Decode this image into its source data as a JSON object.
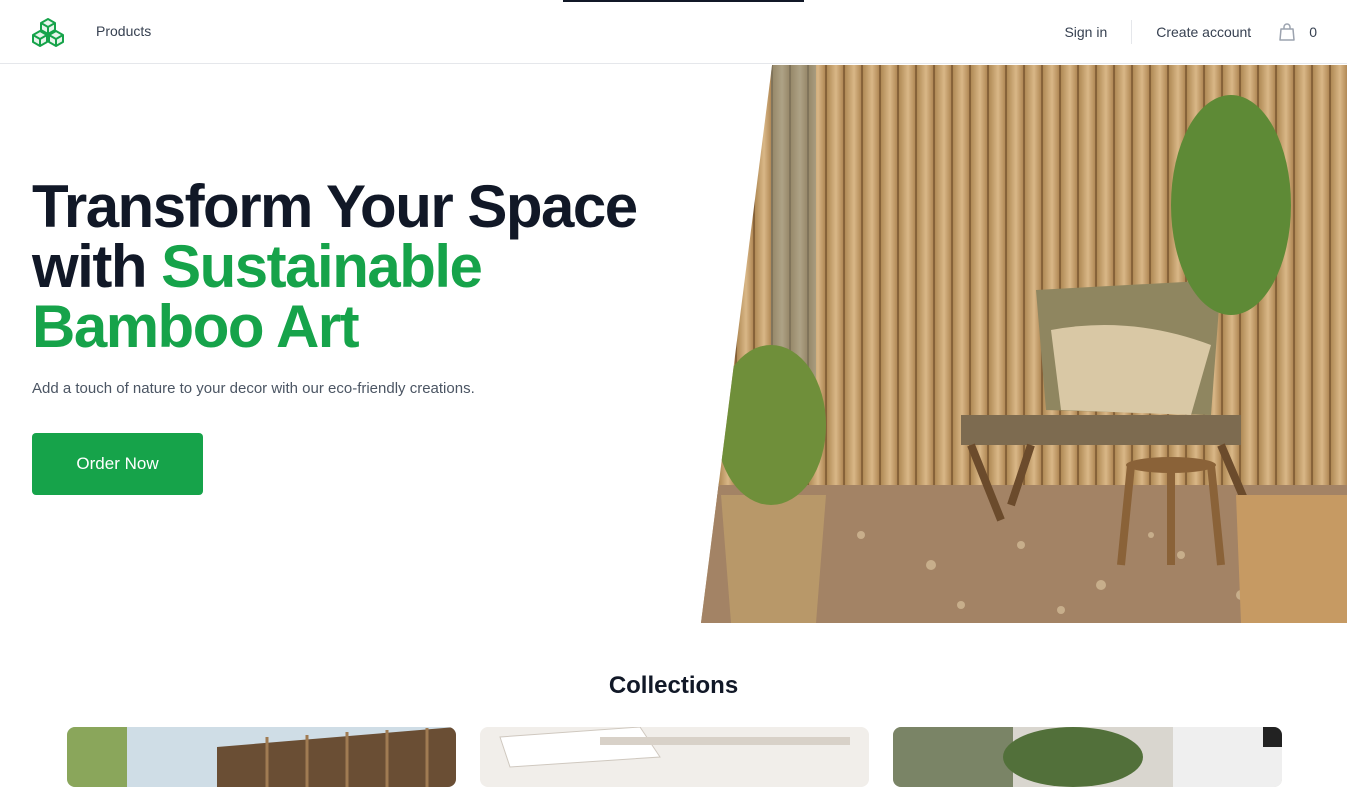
{
  "header": {
    "logo_icon": "cubes-logo-icon",
    "products_label": "Products",
    "sign_in_label": "Sign in",
    "create_account_label": "Create account",
    "cart_icon": "shopping-bag-icon",
    "cart_count": "0"
  },
  "hero": {
    "title_line1": "Transform Your Space",
    "title_with": "with ",
    "title_accent_line2": "Sustainable",
    "title_accent_line3": "Bamboo Art",
    "subtitle": "Add a touch of nature to your decor with our eco-friendly creations.",
    "cta_label": "Order Now",
    "image": "bamboo-patio-chair-photo"
  },
  "collections": {
    "title": "Collections",
    "cards": [
      {
        "image": "bamboo-house-photo"
      },
      {
        "image": "white-interior-photo"
      },
      {
        "image": "hanging-plants-photo"
      }
    ]
  },
  "colors": {
    "brand_green": "#16a34a",
    "text_dark": "#111827",
    "text_muted": "#4b5563",
    "border": "#e5e7eb"
  }
}
